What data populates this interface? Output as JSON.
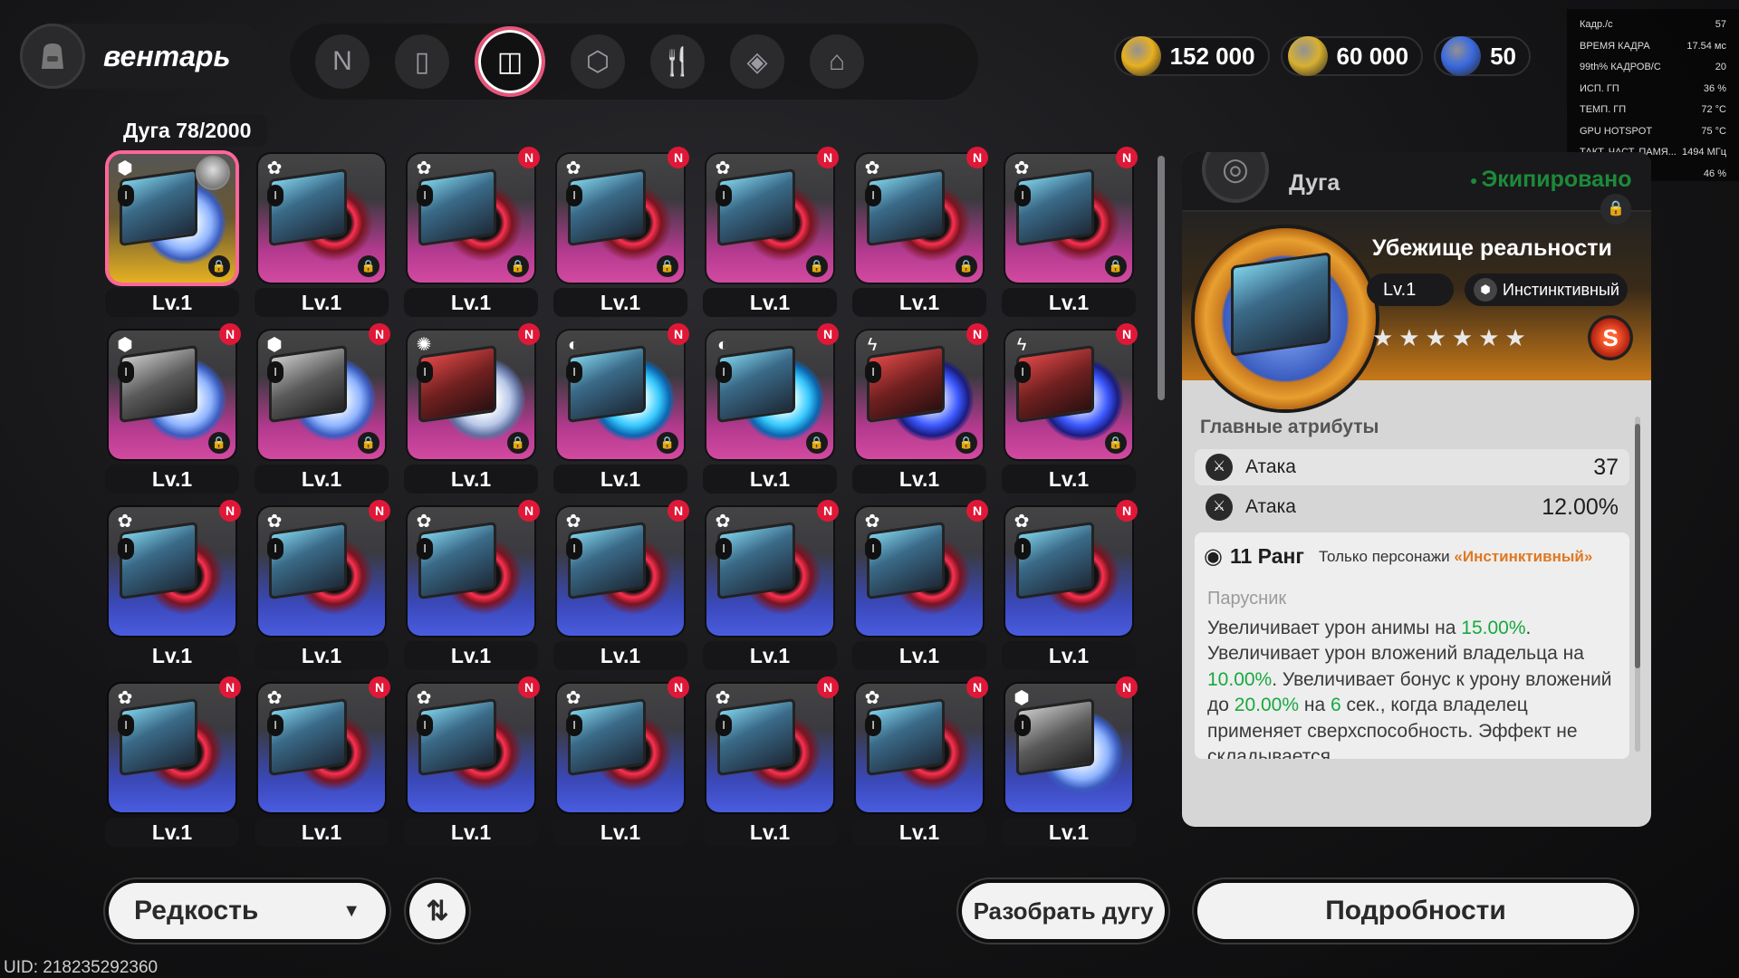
{
  "header": {
    "title": "вентарь",
    "active_category": "Дуга",
    "categories": [
      {
        "name": "n-logo-icon",
        "glyph": "N"
      },
      {
        "name": "device-icon",
        "glyph": "▯"
      },
      {
        "name": "disc-icon",
        "glyph": "◫"
      },
      {
        "name": "cube-icon",
        "glyph": "⬡"
      },
      {
        "name": "cutlery-icon",
        "glyph": "🍴"
      },
      {
        "name": "package-icon",
        "glyph": "◈"
      },
      {
        "name": "home-icon",
        "glyph": "⌂"
      }
    ],
    "currencies": [
      {
        "name": "gold-coin",
        "value": "152 000",
        "color": "#e8b020"
      },
      {
        "name": "ticket",
        "value": "60 000",
        "color": "#d8b030"
      },
      {
        "name": "blue-gem",
        "value": "50",
        "color": "#3a6ae0"
      }
    ]
  },
  "perf": [
    {
      "k": "Кадр./с",
      "v": "57"
    },
    {
      "k": "ВРЕМЯ КАДРА",
      "v": "17.54 мс"
    },
    {
      "k": "99th% КАДРОВ/С",
      "v": "20"
    },
    {
      "k": "ИСП. ГП",
      "v": "36 %"
    },
    {
      "k": "ТЕМП. ГП",
      "v": "72 °C"
    },
    {
      "k": "GPU HOTSPOT",
      "v": "75 °C"
    },
    {
      "k": "ТАКТ. ЧАСТ. ПАМЯ...",
      "v": "1494 МГц"
    },
    {
      "k": "ИСП. ЦП",
      "v": "46 %"
    }
  ],
  "inventory": {
    "count_label": "Дуга",
    "count": "78/2000",
    "items": [
      {
        "level": "Lv.1",
        "bg": "gold",
        "disc": "white",
        "box": "blue",
        "type": "⬢",
        "new": false,
        "locked": true,
        "selected": true
      },
      {
        "level": "Lv.1",
        "bg": "pink",
        "disc": "red",
        "box": "blue",
        "type": "✿",
        "new": false,
        "locked": true
      },
      {
        "level": "Lv.1",
        "bg": "pink",
        "disc": "red",
        "box": "blue",
        "type": "✿",
        "new": true,
        "locked": true
      },
      {
        "level": "Lv.1",
        "bg": "pink",
        "disc": "red",
        "box": "blue",
        "type": "✿",
        "new": true,
        "locked": true
      },
      {
        "level": "Lv.1",
        "bg": "pink",
        "disc": "red",
        "box": "blue",
        "type": "✿",
        "new": true,
        "locked": true
      },
      {
        "level": "Lv.1",
        "bg": "pink",
        "disc": "red",
        "box": "blue",
        "type": "✿",
        "new": true,
        "locked": true
      },
      {
        "level": "Lv.1",
        "bg": "pink",
        "disc": "red",
        "box": "blue",
        "type": "✿",
        "new": true,
        "locked": true
      },
      {
        "level": "Lv.1",
        "bg": "pink",
        "disc": "white",
        "box": "gray",
        "type": "⬢",
        "new": true,
        "locked": true
      },
      {
        "level": "Lv.1",
        "bg": "pink",
        "disc": "white",
        "box": "gray",
        "type": "⬢",
        "new": true,
        "locked": true
      },
      {
        "level": "Lv.1",
        "bg": "pink",
        "disc": "swirl",
        "box": "red",
        "type": "✺",
        "new": true,
        "locked": true
      },
      {
        "level": "Lv.1",
        "bg": "pink",
        "disc": "cyan",
        "box": "blue",
        "type": "◐",
        "new": true,
        "locked": true
      },
      {
        "level": "Lv.1",
        "bg": "pink",
        "disc": "cyan",
        "box": "blue",
        "type": "◐",
        "new": true,
        "locked": true
      },
      {
        "level": "Lv.1",
        "bg": "pink",
        "disc": "storm",
        "box": "red",
        "type": "ϟ",
        "new": true,
        "locked": true
      },
      {
        "level": "Lv.1",
        "bg": "pink",
        "disc": "storm",
        "box": "red",
        "type": "ϟ",
        "new": true,
        "locked": true
      },
      {
        "level": "Lv.1",
        "bg": "blue",
        "disc": "red",
        "box": "blue",
        "type": "✿",
        "new": true,
        "locked": false
      },
      {
        "level": "Lv.1",
        "bg": "blue",
        "disc": "red",
        "box": "blue",
        "type": "✿",
        "new": true,
        "locked": false
      },
      {
        "level": "Lv.1",
        "bg": "blue",
        "disc": "red",
        "box": "blue",
        "type": "✿",
        "new": true,
        "locked": false
      },
      {
        "level": "Lv.1",
        "bg": "blue",
        "disc": "red",
        "box": "blue",
        "type": "✿",
        "new": true,
        "locked": false
      },
      {
        "level": "Lv.1",
        "bg": "blue",
        "disc": "red",
        "box": "blue",
        "type": "✿",
        "new": true,
        "locked": false
      },
      {
        "level": "Lv.1",
        "bg": "blue",
        "disc": "red",
        "box": "blue",
        "type": "✿",
        "new": true,
        "locked": false
      },
      {
        "level": "Lv.1",
        "bg": "blue",
        "disc": "red",
        "box": "blue",
        "type": "✿",
        "new": true,
        "locked": false
      },
      {
        "level": "Lv.1",
        "bg": "blue",
        "disc": "red",
        "box": "blue",
        "type": "✿",
        "new": true,
        "locked": false
      },
      {
        "level": "Lv.1",
        "bg": "blue",
        "disc": "red",
        "box": "blue",
        "type": "✿",
        "new": true,
        "locked": false
      },
      {
        "level": "Lv.1",
        "bg": "blue",
        "disc": "red",
        "box": "blue",
        "type": "✿",
        "new": true,
        "locked": false
      },
      {
        "level": "Lv.1",
        "bg": "blue",
        "disc": "red",
        "box": "blue",
        "type": "✿",
        "new": true,
        "locked": false
      },
      {
        "level": "Lv.1",
        "bg": "blue",
        "disc": "red",
        "box": "blue",
        "type": "✿",
        "new": true,
        "locked": false
      },
      {
        "level": "Lv.1",
        "bg": "blue",
        "disc": "red",
        "box": "blue",
        "type": "✿",
        "new": true,
        "locked": false
      },
      {
        "level": "Lv.1",
        "bg": "blue",
        "disc": "white",
        "box": "gray",
        "type": "⬢",
        "new": true,
        "locked": false
      }
    ]
  },
  "badges": {
    "new": "N",
    "rank": "I"
  },
  "detail": {
    "category": "Дуга",
    "status": "Экипировано",
    "item_name": "Убежище реальности",
    "level": "Lv.1",
    "class": "Инстинктивный",
    "stars": "★★★★★★",
    "rarity": "S",
    "main_attrs_title": "Главные атрибуты",
    "attrs": [
      {
        "name": "Атака",
        "value": "37"
      },
      {
        "name": "Атака",
        "value": "12.00%"
      }
    ],
    "rank": "11 Ранг",
    "rank_req_prefix": "Только персонажи",
    "rank_req_class": "«Инстинктивный»",
    "skill_name": "Парусник",
    "skill_parts": [
      {
        "t": "Увеличивает урон анимы на ",
        "g": false
      },
      {
        "t": "15.00%",
        "g": true
      },
      {
        "t": ". Увеличивает урон вложений владельца на ",
        "g": false
      },
      {
        "t": "10.00%",
        "g": true
      },
      {
        "t": ". Увеличивает бонус к урону вложений до ",
        "g": false
      },
      {
        "t": "20.00%",
        "g": true
      },
      {
        "t": " на ",
        "g": false
      },
      {
        "t": "6",
        "g": true
      },
      {
        "t": " сек., когда владелец применяет сверхспособность. Эффект не складывается.",
        "g": false
      }
    ]
  },
  "footer": {
    "sort_label": "Редкость",
    "dismantle_label": "Разобрать дугу",
    "details_label": "Подробности",
    "uid": "UID: 218235292360"
  }
}
